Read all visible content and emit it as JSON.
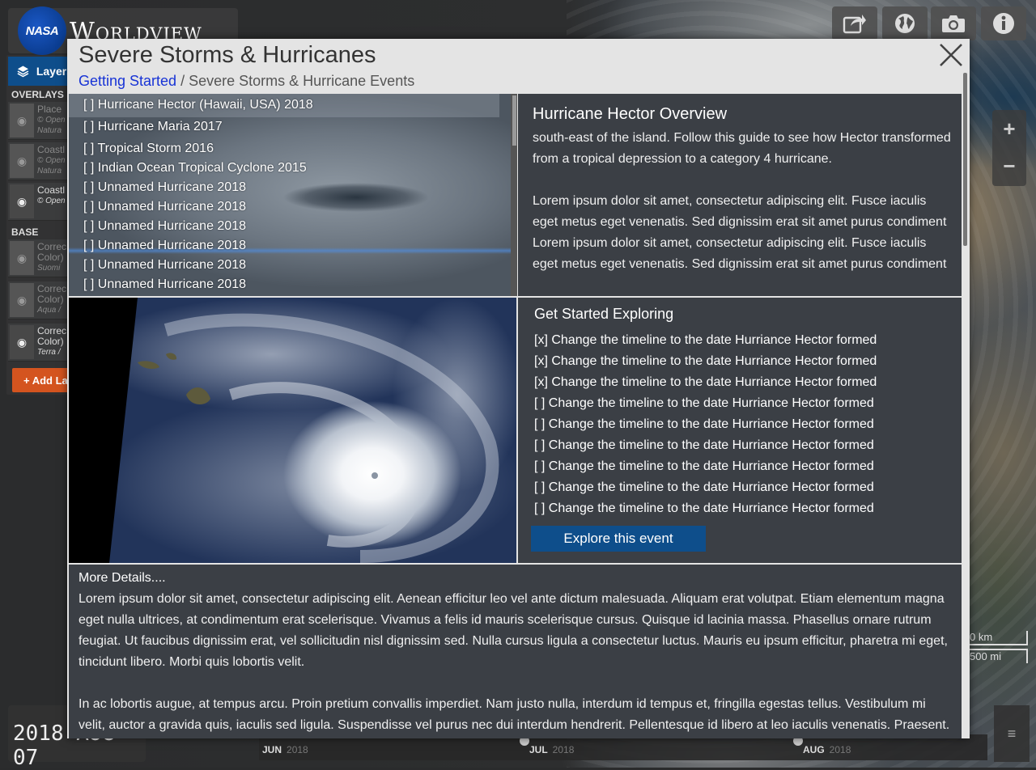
{
  "app": {
    "title": "Worldview",
    "logo_text": "NASA"
  },
  "layers_panel": {
    "tab_label": "Layers",
    "overlays_heading": "OVERLAYS",
    "base_layers_heading": "BASE LAYERS",
    "overlays": [
      {
        "name": "Place",
        "source": "© Open",
        "sub": "Natura",
        "visible": false
      },
      {
        "name": "Coastl",
        "source": "© Open",
        "sub": "Natura",
        "visible": false
      },
      {
        "name": "Coastl",
        "source": "© Open",
        "sub": "",
        "visible": true
      }
    ],
    "base_layers": [
      {
        "name": "Correc",
        "line2": "Color)",
        "sub": "Suomi",
        "visible": false
      },
      {
        "name": "Correc",
        "line2": "Color)",
        "sub": "Aqua /",
        "visible": false
      },
      {
        "name": "Correc",
        "line2": "Color)",
        "sub": "Terra /",
        "visible": true
      }
    ],
    "add_layers_label": "+ Add La"
  },
  "toolbar": {
    "icons": [
      "share-icon",
      "globe-icon",
      "camera-icon",
      "info-icon"
    ]
  },
  "zoom": {
    "plus": "+",
    "minus": "−"
  },
  "scale": {
    "km": "0 km",
    "mi": "500 mi"
  },
  "timeline": {
    "date_text": "2018 AUG 07",
    "months": [
      {
        "label": "JUN",
        "year": "2018"
      },
      {
        "label": "JUL",
        "year": "2018"
      },
      {
        "label": "AUG",
        "year": "2018"
      }
    ]
  },
  "modal": {
    "title": "Severe Storms & Hurricanes",
    "breadcrumb_link": "Getting Started",
    "breadcrumb_sep": " / ",
    "breadcrumb_current": "Severe Storms & Hurricane Events",
    "events": [
      "[ ] Hurricane Hector (Hawaii, USA) 2018",
      "[ ] Hurricane Maria 2017",
      "[ ] Tropical Storm 2016",
      "[ ] Indian Ocean Tropical Cyclone 2015",
      "[ ] Unnamed Hurricane 2018",
      "[ ] Unnamed Hurricane 2018",
      "[ ] Unnamed Hurricane 2018",
      "[ ] Unnamed Hurricane 2018",
      "[ ] Unnamed Hurricane 2018",
      "[ ] Unnamed Hurricane 2018"
    ],
    "overview": {
      "title": "Hurricane Hector Overview",
      "paragraphs": [
        "south-east of the island. Follow this guide to see how Hector transformed from a tropical depression to a category 4 hurricane.",
        "Lorem ipsum dolor sit amet, consectetur adipiscing elit. Fusce iaculis eget metus eget venenatis. Sed dignissim erat sit amet purus condiment Lorem ipsum dolor sit amet, consectetur adipiscing elit. Fusce iaculis eget metus eget venenatis. Sed dignissim erat sit amet purus condiment"
      ]
    },
    "explore": {
      "title": "Get Started Exploring",
      "tasks": [
        "[x] Change the timeline to the date Hurriance Hector formed",
        "[x] Change the timeline to the date Hurriance Hector formed",
        "[x] Change the timeline to the date Hurriance Hector formed",
        "[ ] Change the timeline to the date Hurriance Hector formed",
        "[ ] Change the timeline to the date Hurriance Hector formed",
        "[ ] Change the timeline to the date Hurriance Hector formed",
        "[ ] Change the timeline to the date Hurriance Hector formed",
        "[ ] Change the timeline to the date Hurriance Hector formed",
        "[ ] Change the timeline to the date Hurriance Hector formed"
      ],
      "button_label": "Explore this event"
    },
    "details": {
      "title": "More Details....",
      "paragraphs": [
        "Lorem ipsum dolor sit amet, consectetur adipiscing elit. Aenean efficitur leo vel ante dictum malesuada. Aliquam erat volutpat. Etiam elementum magna eget nulla ultrices, at condimentum erat scelerisque. Vivamus a felis id mauris scelerisque cursus. Quisque id lacinia massa. Phasellus ornare rutrum feugiat. Ut faucibus dignissim erat, vel sollicitudin nisl dignissim sed. Nulla cursus ligula a consectetur luctus. Mauris eu ipsum efficitur, pharetra mi eget, tincidunt libero. Morbi quis lobortis velit.",
        "In ac lobortis augue, at tempus arcu. Proin pretium convallis imperdiet. Nam justo nulla, interdum id tempus et, fringilla egestas tellus. Vestibulum mi velit, auctor a gravida quis, iaculis sed ligula. Suspendisse vel purus nec dui interdum hendrerit. Pellentesque id libero at leo iaculis venenatis. Praesent."
      ]
    }
  },
  "colors": {
    "accent": "#0e4e8b",
    "add_button": "#d4541f",
    "link": "#1733d6",
    "pane_bg": "#3b3f45"
  }
}
